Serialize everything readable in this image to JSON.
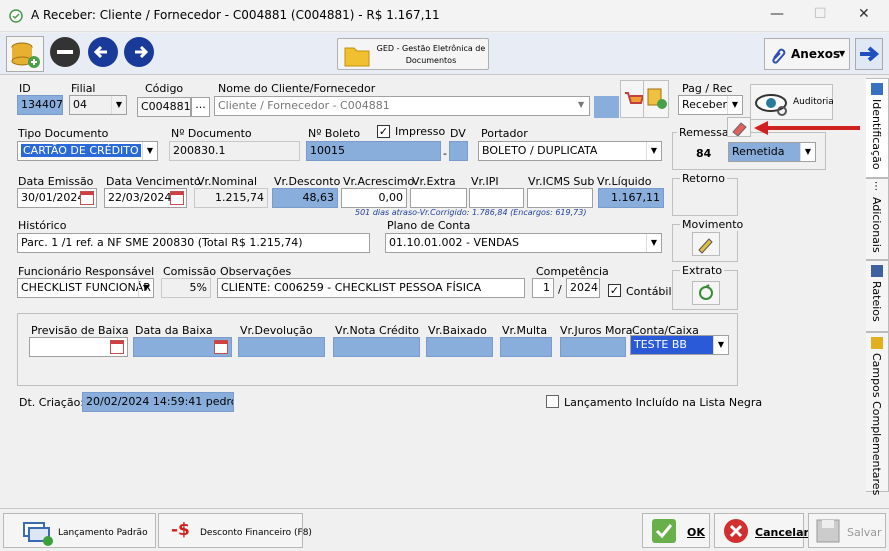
{
  "window": {
    "title": "A Receber: Cliente / Fornecedor - C004881 (C004881) - R$ 1.167,11"
  },
  "toolbar": {
    "ged_label": "GED - Gestão Eletrônica de Documentos",
    "anexos_label": "Anexos"
  },
  "form": {
    "id_label": "ID",
    "id_value": "134407",
    "filial_label": "Filial",
    "filial_value": "04",
    "codigo_label": "Código",
    "codigo_value": "C004881",
    "codigo_btn": "...",
    "nome_label": "Nome do Cliente/Fornecedor",
    "nome_placeholder": "Cliente / Fornecedor - C004881",
    "pagrec_label": "Pag / Rec",
    "pagrec_value": "Receber",
    "auditoria_label": "Auditoria",
    "tipo_doc_label": "Tipo Documento",
    "tipo_doc_value": "CARTÃO DE CRÉDITO",
    "n_doc_label": "Nº Documento",
    "n_doc_value": "200830.1",
    "n_boleto_label": "Nº Boleto",
    "n_boleto_value": "10015",
    "impresso_label": "Impresso",
    "impresso_check": "✓",
    "dv_label": "DV",
    "dv_dash": "-",
    "portador_label": "Portador",
    "portador_value": "BOLETO / DUPLICATA",
    "remessa_label": "Remessa",
    "remessa_num": "84",
    "remessa_status": "Remetida",
    "data_emissao_label": "Data Emissão",
    "data_emissao_value": "30/01/2024",
    "data_venc_label": "Data Vencimento",
    "data_venc_value": "22/03/2024",
    "vr_nominal_label": "Vr.Nominal",
    "vr_nominal_value": "1.215,74",
    "vr_desconto_label": "Vr.Desconto",
    "vr_desconto_value": "48,63",
    "vr_acrescimo_label": "Vr.Acrescimo",
    "vr_acrescimo_value": "0,00",
    "vr_extra_label": "Vr.Extra",
    "vr_ipi_label": "Vr.IPI",
    "vr_icms_label": "Vr.ICMS Sub",
    "vr_liquido_label": "Vr.Líquido",
    "vr_liquido_value": "1.167,11",
    "atraso_note": "501 dias atraso-Vr.Corrigido: 1.786,84 (Encargos: 619,73)",
    "retorno_label": "Retorno",
    "historico_label": "Histórico",
    "historico_value": "Parc. 1 /1  ref. a NF SME 200830 (Total R$ 1.215,74)",
    "plano_label": "Plano de Conta",
    "plano_value": "01.10.01.002  -  VENDAS",
    "movimento_label": "Movimento",
    "func_label": "Funcionário Responsável",
    "func_value": "CHECKLIST FUNCIONÁR",
    "comissao_label": "Comissão",
    "comissao_value": "5%",
    "obs_label": "Observações",
    "obs_value": "CLIENTE: C006259 - CHECKLIST PESSOA FÍSICA",
    "competencia_label": "Competência",
    "comp_mes": "1",
    "comp_sep": "/",
    "comp_ano": "2024",
    "contabil_label": "Contábil",
    "contabil_check": "✓",
    "extrato_label": "Extrato",
    "prev_baixa_label": "Previsão de Baixa",
    "data_baixa_label": "Data da Baixa",
    "vr_devolucao_label": "Vr.Devolução",
    "vr_nota_credito_label": "Vr.Nota Crédito",
    "vr_baixado_label": "Vr.Baixado",
    "vr_multa_label": "Vr.Multa",
    "vr_juros_label": "Vr.Juros Mora",
    "conta_caixa_label": "Conta/Caixa",
    "conta_caixa_value": "TESTE BB",
    "dt_criacao_label": "Dt. Criação:",
    "dt_criacao_value": "20/02/2024 14:59:41 pedro",
    "lista_negra_label": "Lançamento Incluído na Lista Negra"
  },
  "side_tabs": [
    "Identificação",
    "Adicionais",
    "Rateios",
    "Campos Complementares"
  ],
  "bottom": {
    "lanc_padrao": "Lançamento Padrão",
    "desconto": "Desconto Financeiro (F8)",
    "ok": "OK",
    "cancelar": "Cancelar",
    "salvar": "Salvar"
  }
}
